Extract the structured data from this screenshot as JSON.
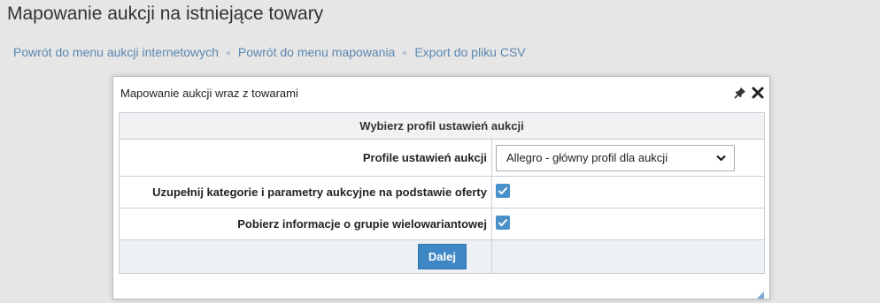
{
  "page": {
    "title": "Mapowanie aukcji na istniejące towary"
  },
  "nav": {
    "links": [
      "Powrót do menu aukcji internetowych",
      "Powrót do menu mapowania",
      "Export do pliku CSV"
    ]
  },
  "dialog": {
    "title": "Mapowanie aukcji wraz z towarami",
    "icons": [
      "pin-icon",
      "close-icon"
    ],
    "section_header": "Wybierz profil ustawień aukcji",
    "fields": {
      "profile_label": "Profile ustawień aukcji",
      "profile_value": "Allegro - główny profil dla aukcji",
      "categories_label": "Uzupełnij kategorie i parametry aukcyjne na podstawie oferty",
      "categories_checked": true,
      "variants_label": "Pobierz informacje o grupie wielowariantowej",
      "variants_checked": true
    },
    "next_button": "Dalej"
  },
  "colors": {
    "background": "#e6e6e6",
    "link": "#5b87b2",
    "accent": "#3f87c4",
    "checkbox": "#4a90c9"
  }
}
